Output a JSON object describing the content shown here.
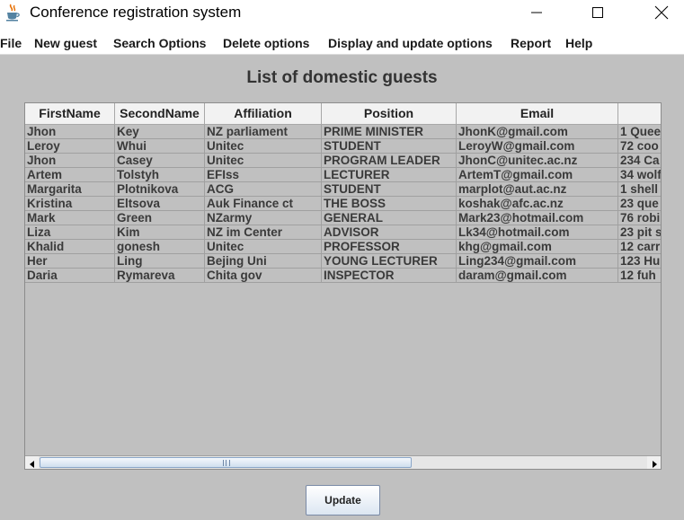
{
  "window": {
    "title": "Conference registration system",
    "icon": "java-cup-icon"
  },
  "menu": [
    {
      "label": "File"
    },
    {
      "label": "New guest"
    },
    {
      "label": "Search Options"
    },
    {
      "label": "Delete options"
    },
    {
      "label": "Display and update options"
    },
    {
      "label": "Report"
    },
    {
      "label": "Help"
    }
  ],
  "main": {
    "heading": "List of domestic guests",
    "update_label": "Update"
  },
  "table": {
    "columns": [
      "FirstName",
      "SecondName",
      "Affiliation",
      "Position",
      "Email",
      ""
    ],
    "rows": [
      [
        "Jhon",
        "Key",
        "NZ parliament",
        "PRIME MINISTER",
        "JhonK@gmail.com",
        "1 Quee"
      ],
      [
        "Leroy",
        "Whui",
        "Unitec",
        "STUDENT",
        "LeroyW@gmail.com",
        "72 coo"
      ],
      [
        "Jhon",
        "Casey",
        "Unitec",
        "PROGRAM LEADER",
        "JhonC@unitec.ac.nz",
        "234 Ca"
      ],
      [
        "Artem",
        "Tolstyh",
        "EFIss",
        "LECTURER",
        "ArtemT@gmail.com",
        "34 wolf"
      ],
      [
        "Margarita",
        "Plotnikova",
        "ACG",
        "STUDENT",
        "marplot@aut.ac.nz",
        "1 shell"
      ],
      [
        "Kristina",
        "Eltsova",
        "Auk Finance ct",
        "THE BOSS",
        "koshak@afc.ac.nz",
        "23 que"
      ],
      [
        "Mark",
        "Green",
        "NZarmy",
        "GENERAL",
        "Mark23@hotmail.com",
        "76 robi"
      ],
      [
        "Liza",
        "Kim",
        "NZ im Center",
        "ADVISOR",
        "Lk34@hotmail.com",
        "23 pit s"
      ],
      [
        "Khalid",
        "gonesh",
        "Unitec",
        "PROFESSOR",
        "khg@gmail.com",
        "12 carr"
      ],
      [
        "Her",
        "Ling",
        "Bejing Uni",
        "YOUNG LECTURER",
        "Ling234@gmail.com",
        "123 Hu"
      ],
      [
        "Daria",
        "Rymareva",
        "Chita gov",
        "INSPECTOR",
        "daram@gmail.com",
        "12 fuh"
      ]
    ]
  },
  "colors": {
    "background": "#c0c0c0",
    "scroll_thumb": "#cfdeee"
  }
}
